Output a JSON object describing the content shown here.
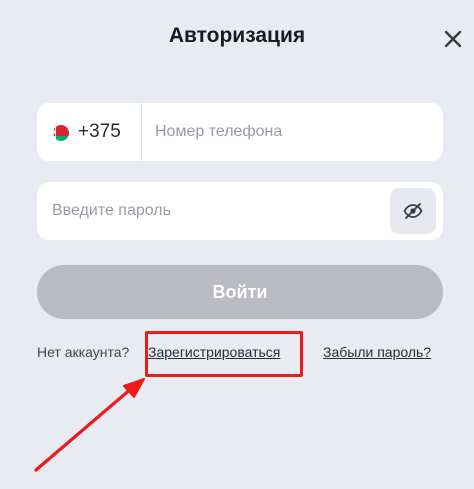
{
  "header": {
    "title": "Авторизация",
    "close_icon": "close-icon"
  },
  "phone": {
    "flag_icon": "belarus-flag-icon",
    "country_code": "+375",
    "placeholder": "Номер телефона",
    "value": ""
  },
  "password": {
    "placeholder": "Введите пароль",
    "value": "",
    "toggle_icon": "eye-off-icon"
  },
  "login_button": {
    "label": "Войти"
  },
  "footer": {
    "no_account_text": "Нет аккаунта?",
    "register_link": "Зарегистрироваться",
    "forgot_link": "Забыли пароль?"
  },
  "annotation": {
    "color": "#ee1a1a"
  },
  "colors": {
    "background": "#e9ebf3",
    "field": "#ffffff",
    "button_disabled": "#b9bac2"
  }
}
